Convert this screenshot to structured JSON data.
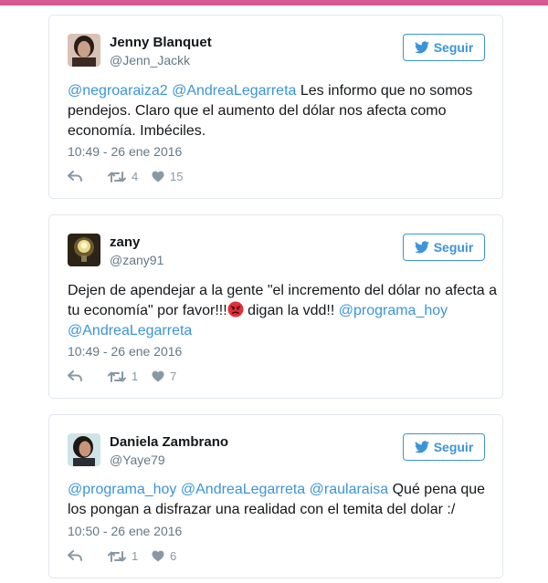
{
  "colors": {
    "accent": "#3b94d9",
    "mention": "#3b94d9",
    "top_bar": "#d6598f",
    "muted": "#657786"
  },
  "follow_label": "Seguir",
  "icons": {
    "follow": "twitter-bird-icon",
    "reply": "reply-icon",
    "retweet": "retweet-icon",
    "like": "heart-icon"
  },
  "tweets": [
    {
      "name": "Jenny Blanquet",
      "handle": "@Jenn_Jackk",
      "mention_1": "@negroaraiza2",
      "mention_2": "@AndreaLegarreta",
      "text_1": " Les informo que no somos pendejos. Claro que el aumento del dólar nos afecta como economía. Imbéciles.",
      "timestamp": "10:49 - 26 ene 2016",
      "retweets": "4",
      "likes": "15"
    },
    {
      "name": "zany",
      "handle": "@zany91",
      "text_1": "Dejen de apendejar a la gente \"el incremento del dólar no afecta a tu economía\" por favor!!!",
      "text_2": " digan la vdd!! ",
      "mention_1": "@programa_hoy",
      "mention_2": "@AndreaLegarreta",
      "timestamp": "10:49 - 26 ene 2016",
      "retweets": "1",
      "likes": "7"
    },
    {
      "name": "Daniela Zambrano",
      "handle": "@Yaye79",
      "mention_1": "@programa_hoy",
      "mention_2": "@AndreaLegarreta",
      "mention_3": "@raularaisa",
      "text_1": " Qué pena que los pongan a disfrazar una realidad  con el temita del dolar :/",
      "timestamp": "10:50 - 26 ene 2016",
      "retweets": "1",
      "likes": "6"
    }
  ]
}
